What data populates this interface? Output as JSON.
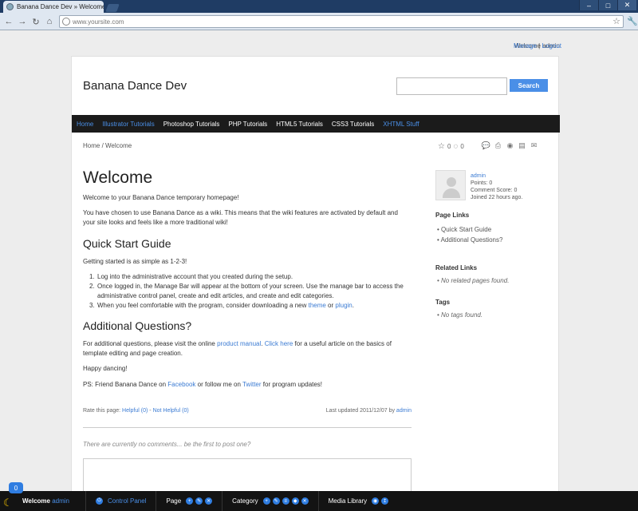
{
  "browser": {
    "tab_title": "Banana Dance Dev » Welcome",
    "tab_close": "×",
    "url_placeholder": "www.yoursite.com",
    "window_buttons": [
      "–",
      "□",
      "✕"
    ]
  },
  "account": {
    "welcome": "Welcome admin",
    "manage": "Manage",
    "divider": "|",
    "logout": "Logout"
  },
  "site": {
    "title": "Banana Dance Dev",
    "search_placeholder": "",
    "search_button": "Search"
  },
  "nav": [
    {
      "label": "Home",
      "active": true
    },
    {
      "label": "Illustrator Tutorials",
      "active": true
    },
    {
      "label": "Photoshop Tutorials",
      "active": false
    },
    {
      "label": "PHP Tutorials",
      "active": false
    },
    {
      "label": "HTML5 Tutorials",
      "active": false
    },
    {
      "label": "CSS3 Tutorials",
      "active": false
    },
    {
      "label": "XHTML Stuff",
      "active": true
    }
  ],
  "breadcrumb": "Home / Welcome",
  "rating": {
    "stars": "0",
    "comments": "0"
  },
  "article": {
    "title": "Welcome",
    "intro": "Welcome to your Banana Dance temporary homepage!",
    "para1": "You have chosen to use Banana Dance as a wiki. This means that the wiki features are activated by default and your site looks and feels like a more traditional wiki!",
    "h_quick": "Quick Start Guide",
    "getting_started": "Getting started is as simple as 1-2-3!",
    "steps": [
      {
        "n": "1.",
        "text": "Log into the administrative account that you created during the setup."
      },
      {
        "n": "2.",
        "text": "Once logged in, the Manage Bar will appear at the bottom of your screen. Use the manage bar to access the administrative control panel, create and edit articles, and create and edit categories."
      },
      {
        "n": "3.",
        "pre": "When you feel comfortable with the program, consider downloading a new ",
        "link1": "theme",
        "mid": " or ",
        "link2": "plugin",
        "post": "."
      }
    ],
    "h_questions": "Additional Questions?",
    "q_pre": "For additional questions, please visit the online ",
    "q_link1": "product manual",
    "q_mid": ". ",
    "q_link2": "Click here",
    "q_post": " for a useful article on the basics of template editing and page creation.",
    "happy": "Happy dancing!",
    "ps_pre": "PS: Friend Banana Dance on ",
    "ps_link1": "Facebook",
    "ps_mid": " or follow me on ",
    "ps_link2": "Twitter",
    "ps_post": " for program updates!"
  },
  "rate": {
    "label": "Rate this page: ",
    "helpful": "Helpful (0)",
    "dash": " - ",
    "not_helpful": "Not Helpful (0)",
    "updated": "Last updated 2011/12/07 by ",
    "by": "admin"
  },
  "comments": {
    "empty": "There are currently no comments... be the first to post one?"
  },
  "sidebar": {
    "user": {
      "name": "admin",
      "points": "Points: 0",
      "comment_score": "Comment Score: 0",
      "joined": "Joined 22 hours ago."
    },
    "page_links_title": "Page Links",
    "page_links": [
      "Quick Start Guide",
      "Additional Questions?"
    ],
    "related_title": "Related Links",
    "related_empty": "No related pages found.",
    "tags_title": "Tags",
    "tags_empty": "No tags found."
  },
  "managebar": {
    "badge": "0",
    "welcome": "Welcome ",
    "user": "admin",
    "control_panel": "Control Panel",
    "page": "Page",
    "category": "Category",
    "media": "Media Library"
  }
}
